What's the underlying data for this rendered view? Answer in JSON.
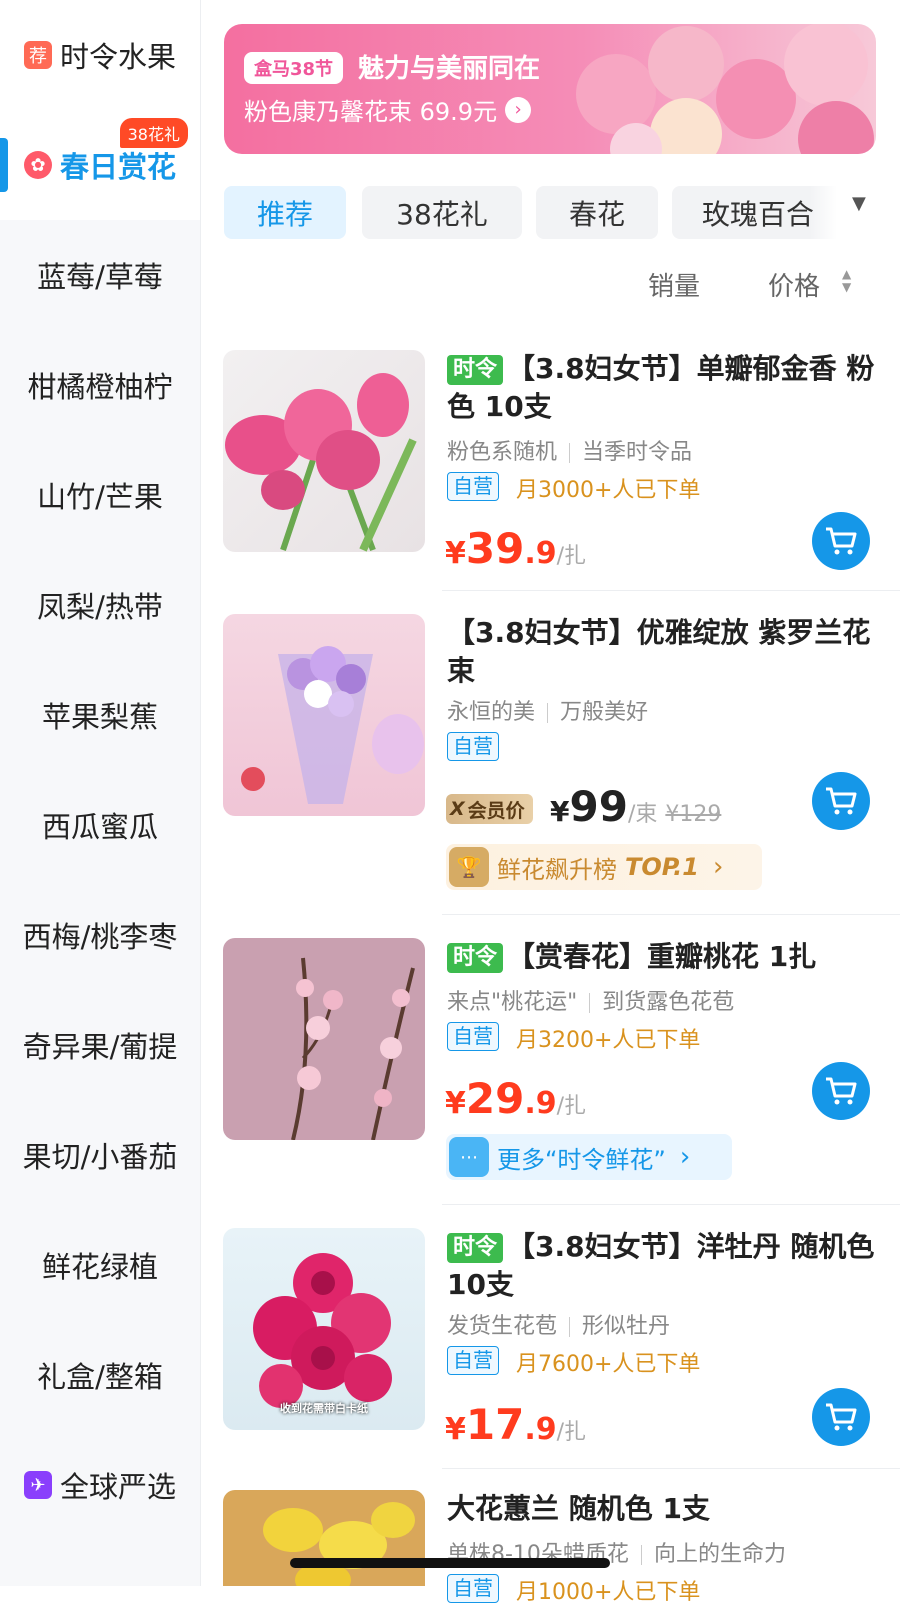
{
  "sidebar": {
    "items": [
      {
        "label": "时令水果",
        "icon": "荐"
      },
      {
        "label": "春日赏花",
        "badge": "38花礼"
      },
      {
        "label": "蓝莓/草莓"
      },
      {
        "label": "柑橘橙柚柠"
      },
      {
        "label": "山竹/芒果"
      },
      {
        "label": "凤梨/热带"
      },
      {
        "label": "苹果梨蕉"
      },
      {
        "label": "西瓜蜜瓜"
      },
      {
        "label": "西梅/桃李枣"
      },
      {
        "label": "奇异果/葡提"
      },
      {
        "label": "果切/小番茄"
      },
      {
        "label": "鲜花绿植"
      },
      {
        "label": "礼盒/整箱"
      },
      {
        "label": "全球严选"
      }
    ]
  },
  "banner": {
    "tag": "盒马38节",
    "title": "魅力与美丽同在",
    "subtitle": "粉色康乃馨花束 69.9元"
  },
  "tabs": [
    "推荐",
    "38花礼",
    "春花",
    "玫瑰百合"
  ],
  "sort": {
    "sales": "销量",
    "price": "价格"
  },
  "products": [
    {
      "tag": "时令",
      "title": "【3.8妇女节】单瓣郁金香 粉色 10支",
      "sub1": "粉色系随机",
      "sub2": "当季时令品",
      "ziying": "自营",
      "monthly": "月3000+人已下单",
      "yen": "¥",
      "price_int": "39",
      "price_dec": ".9",
      "unit": "/扎"
    },
    {
      "title": "【3.8妇女节】优雅绽放 紫罗兰花束",
      "sub1": "永恒的美",
      "sub2": "万般美好",
      "ziying": "自营",
      "vip_label": "会员价",
      "yen": "¥",
      "price_int": "99",
      "unit": "/束",
      "old_price": "¥129",
      "rank_text": "鲜花飙升榜",
      "rank_top": "TOP.1"
    },
    {
      "tag": "时令",
      "title": "【赏春花】重瓣桃花 1扎",
      "sub1": "来点\"桃花运\"",
      "sub2": "到货露色花苞",
      "ziying": "自营",
      "monthly": "月3200+人已下单",
      "yen": "¥",
      "price_int": "29",
      "price_dec": ".9",
      "unit": "/扎",
      "more_text": "更多“时令鲜花”"
    },
    {
      "tag": "时令",
      "title": "【3.8妇女节】洋牡丹 随机色 10支",
      "sub1": "发货生花苞",
      "sub2": "形似牡丹",
      "ziying": "自营",
      "monthly": "月7600+人已下单",
      "yen": "¥",
      "price_int": "17",
      "price_dec": ".9",
      "unit": "/扎",
      "img_caption": "收到花需带白卡纸"
    },
    {
      "title": "大花蕙兰 随机色 1支",
      "sub1": "单株8-10朵蜡质花",
      "sub2": "向上的生命力",
      "ziying": "自营",
      "monthly": "月1000+人已下单"
    }
  ],
  "colors": {
    "accent": "#1597e8",
    "price": "#ff3b1e",
    "shiling_green": "#3dbb4e",
    "monthly_orange": "#d9921e"
  }
}
